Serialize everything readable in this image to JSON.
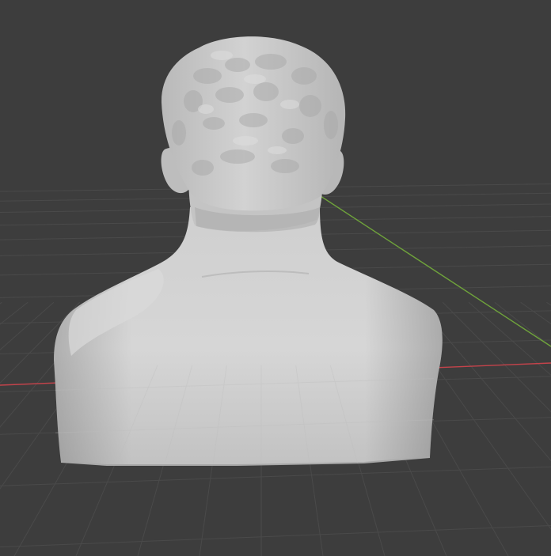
{
  "viewport": {
    "background_color": "#3d3d3d",
    "grid_line_color": "#4a4a4a",
    "x_axis_color": "#c4434b",
    "y_axis_color": "#6fa33b",
    "model_color": "#c9c9c9",
    "model_shadow_color": "#9e9e9e",
    "model_highlight_color": "#dcdcdc"
  }
}
